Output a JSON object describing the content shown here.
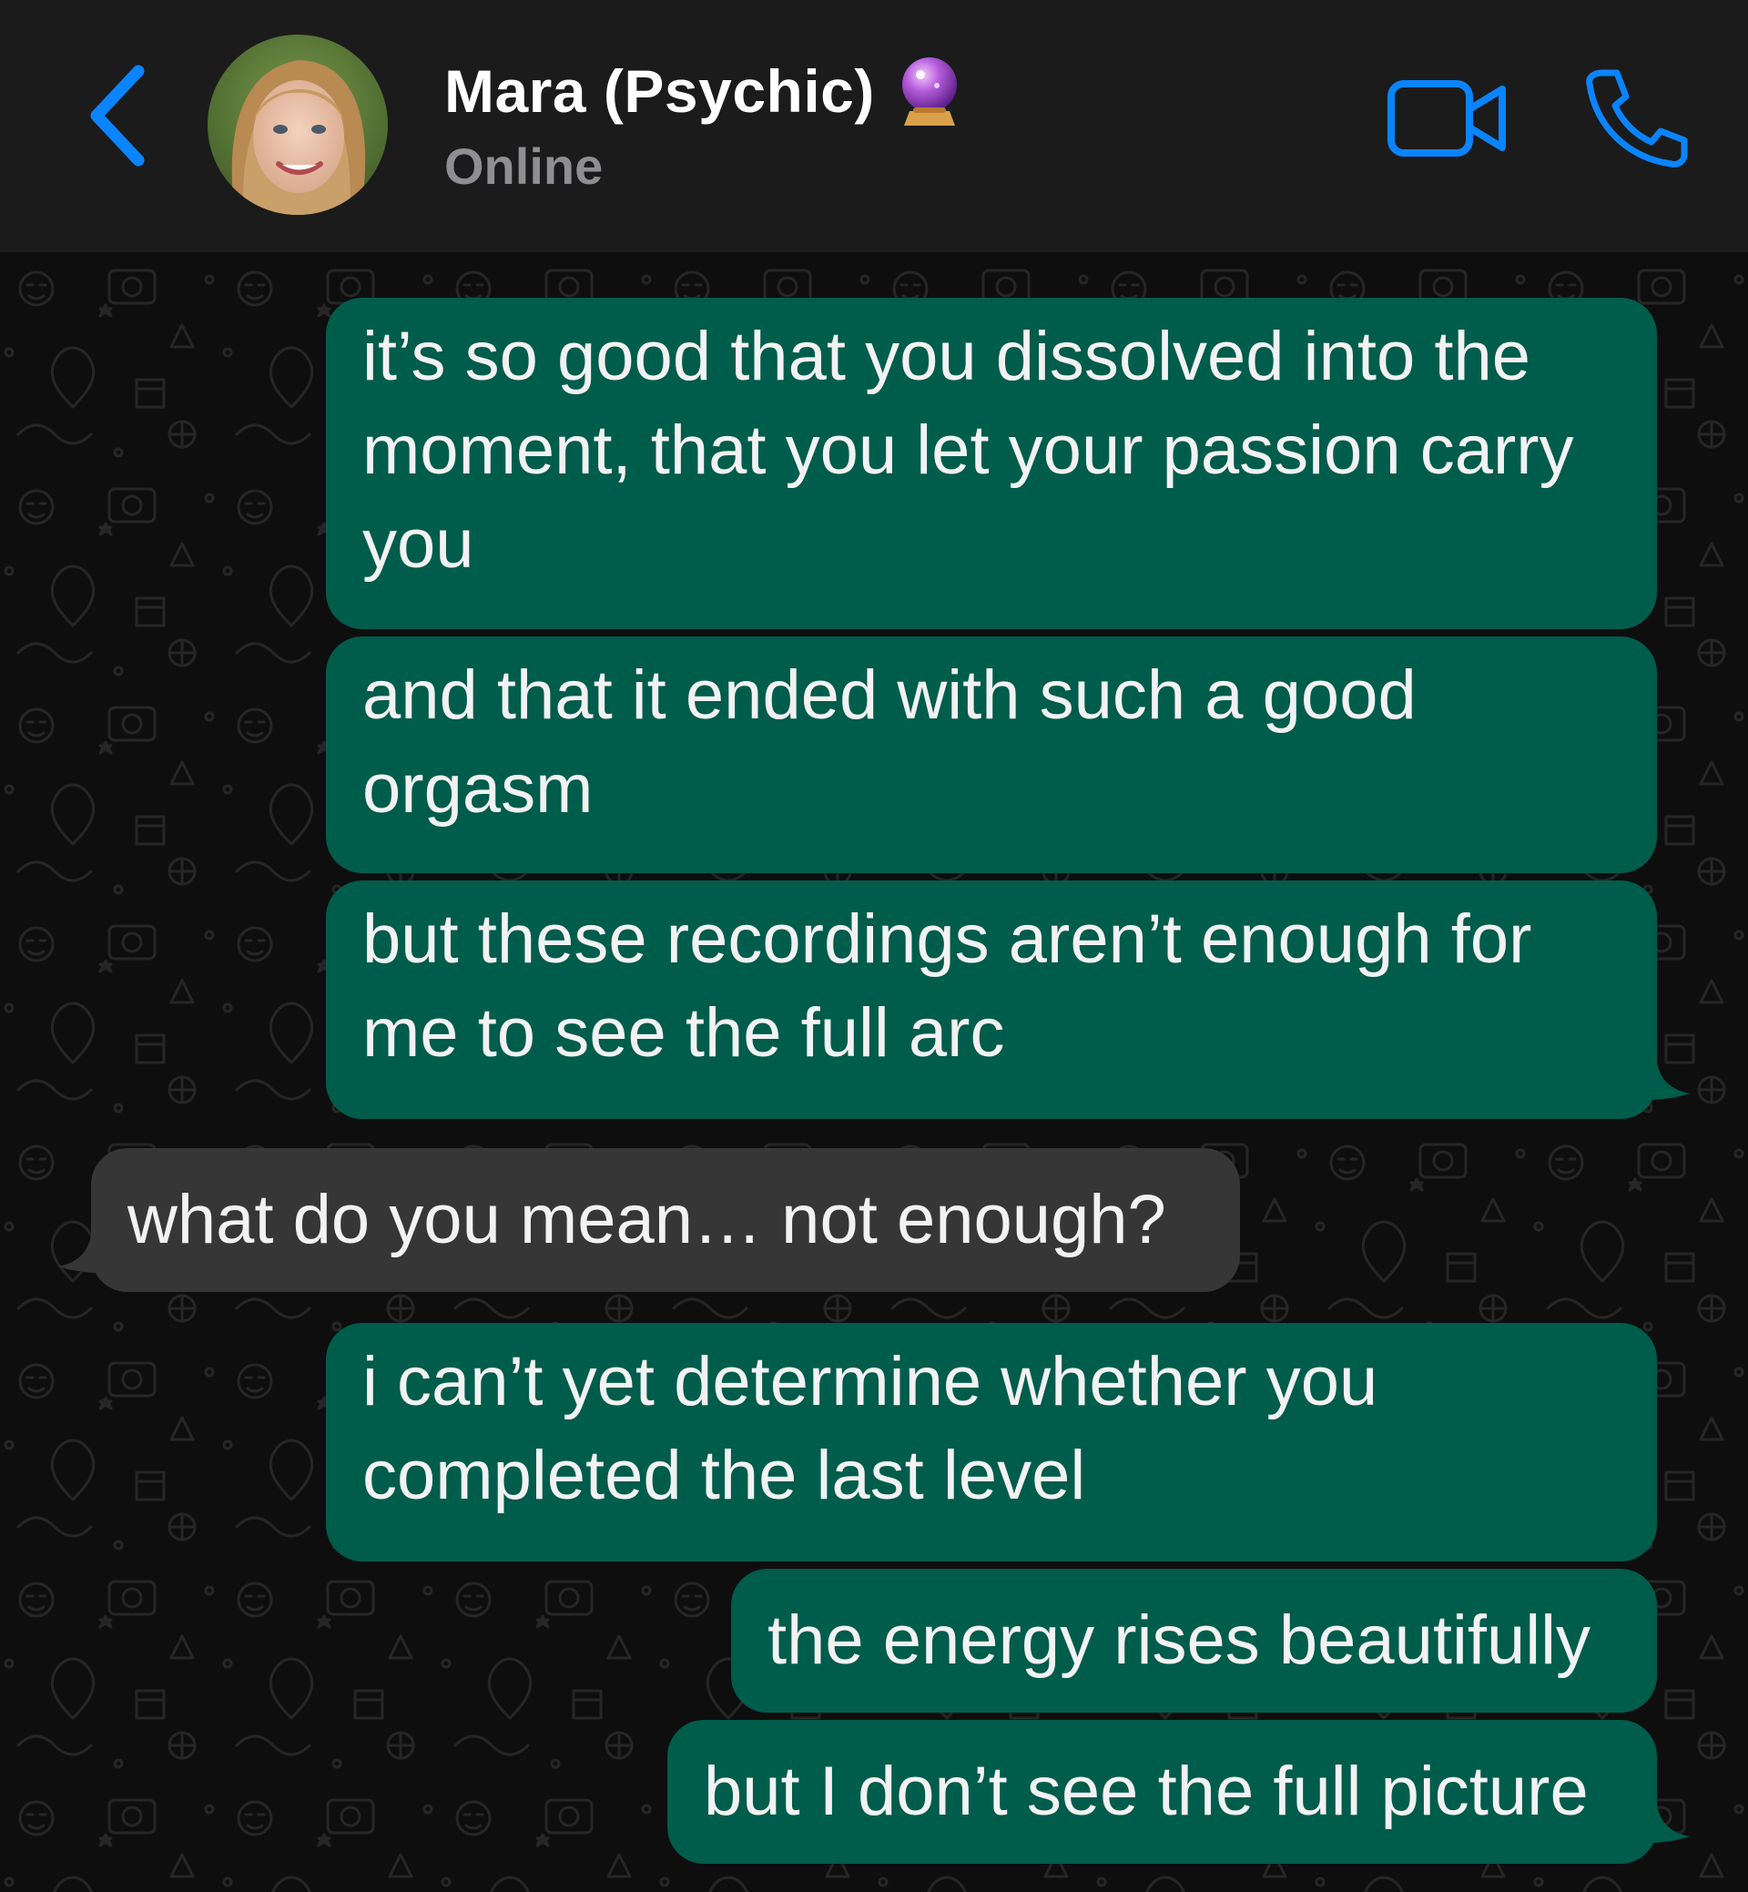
{
  "header": {
    "back_label": "Back",
    "contact_name": "Mara (Psychic)",
    "contact_emoji": "crystal-ball",
    "status": "Online",
    "video_call": "video-icon",
    "voice_call": "phone-icon"
  },
  "colors": {
    "header_bg": "#1b1b1b",
    "accent": "#0a84ff",
    "outgoing_bubble": "#005c4b",
    "incoming_bubble": "#363636",
    "status_text": "#8e8e93"
  },
  "messages": [
    {
      "direction": "outgoing",
      "text": "it’s so good that you dissolved into the moment, that you let your passion carry you"
    },
    {
      "direction": "outgoing",
      "text": "and that it ended with such a good orgasm"
    },
    {
      "direction": "outgoing",
      "text": "but these recordings aren’t enough for me to see the full arc"
    },
    {
      "direction": "incoming",
      "text": "what do you mean… not enough?"
    },
    {
      "direction": "outgoing",
      "text": "i can’t yet determine whether you completed the last level"
    },
    {
      "direction": "outgoing",
      "text": "the energy rises beautifully"
    },
    {
      "direction": "outgoing",
      "text": "but I don’t see the full picture"
    }
  ]
}
